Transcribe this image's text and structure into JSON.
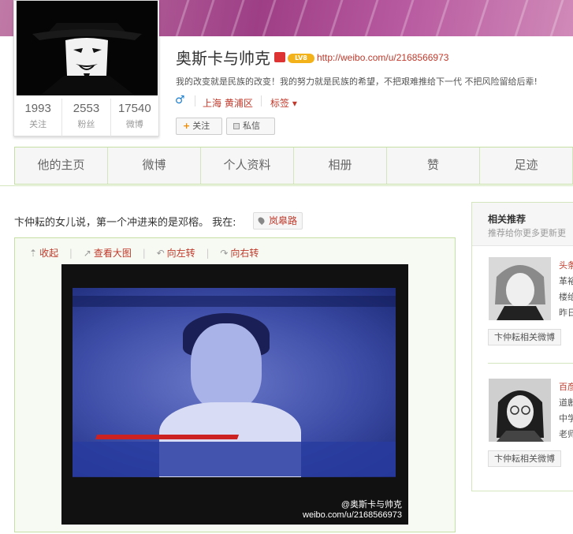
{
  "profile": {
    "name": "奥斯卡与帅克",
    "level_badge": "LV8",
    "url": "http://weibo.com/u/2168566973",
    "bio": "我的改变就是民族的改变！我的努力就是民族的希望，不把艰难推给下一代 不把风险留给后辈!",
    "gender_symbol": "♂",
    "location": "上海 黄浦区",
    "tags_label": "标签 ▾",
    "follow_label": "关注",
    "message_label": "私信",
    "stats": [
      {
        "value": "1993",
        "label": "关注"
      },
      {
        "value": "2553",
        "label": "粉丝"
      },
      {
        "value": "17540",
        "label": "微博"
      }
    ]
  },
  "tabs": [
    "他的主页",
    "微博",
    "个人资料",
    "相册",
    "赞",
    "足迹"
  ],
  "post": {
    "text": "卞仲耘的女儿说，第一个冲进来的是邓榕。 我在:",
    "place": "岚皋路",
    "tools": {
      "collapse": "收起",
      "view_large": "查看大图",
      "rotate_left": "向左转",
      "rotate_right": "向右转"
    },
    "watermark_name": "@奥斯卡与帅克",
    "watermark_url": "weibo.com/u/2168566973"
  },
  "sidebar": {
    "title": "相关推荐",
    "subtitle": "推荐给你更多更新更",
    "items": [
      {
        "title": "头条",
        "lines": [
          "革裕",
          "楼绐",
          "昨日"
        ],
        "button": "卞仲耘相关微博"
      },
      {
        "title": "百彦",
        "lines": [
          "道鄌",
          "中学",
          "老师"
        ],
        "button": "卞仲耘相关微博"
      }
    ]
  },
  "colors": {
    "link_red": "#c0392b",
    "tab_border_green": "#c6dfa5",
    "gender_blue": "#1a7fd1"
  }
}
